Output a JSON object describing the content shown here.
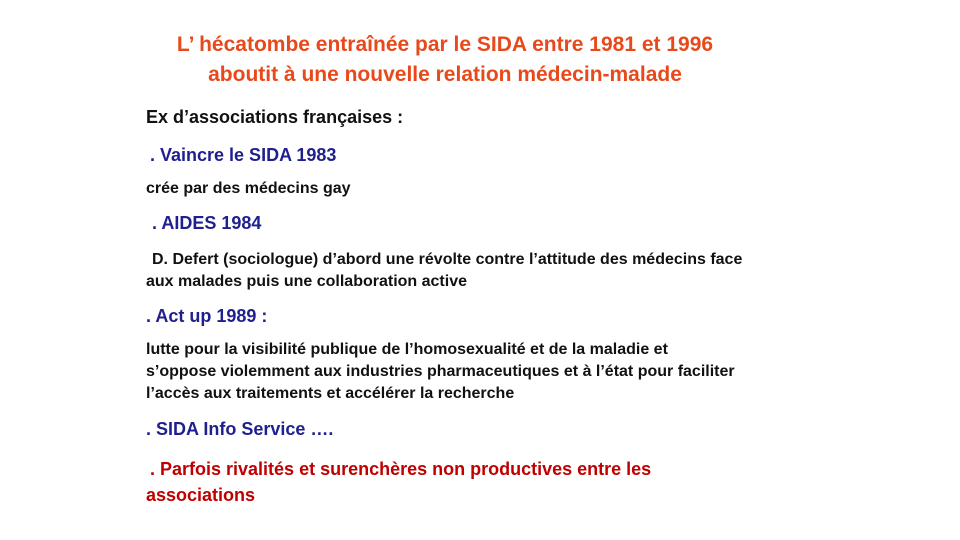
{
  "slide": {
    "title_line1": "L’ hécatombe entraînée par le SIDA entre 1981 et 1996",
    "title_line2": "aboutit à une nouvelle relation médecin-malade",
    "heading": "Ex d’associations françaises :",
    "item1_title": ". Vaincre le SIDA 1983",
    "item1_desc": "crée par des médecins gay",
    "item2_title": ". AIDES  1984",
    "item2_desc_line1": "D. Defert (sociologue) d’abord une révolte contre l’attitude des médecins face",
    "item2_desc_line2": "aux malades puis une collaboration active",
    "item3_title": ". Act up 1989 :",
    "item3_desc_line1": "lutte pour la visibilité publique de l’homosexualité et de la  maladie et",
    "item3_desc_line2": "s’oppose violemment aux industries pharmaceutiques et à l’état pour faciliter",
    "item3_desc_line3": "l’accès aux traitements et accélérer la recherche",
    "item4_title": ". SIDA Info Service ….",
    "note_line1": ". Parfois rivalités et surenchères non productives  entre les",
    "note_line2": "associations"
  },
  "colors": {
    "title": "#e8491b",
    "association": "#1f1f8f",
    "note": "#c00000"
  }
}
